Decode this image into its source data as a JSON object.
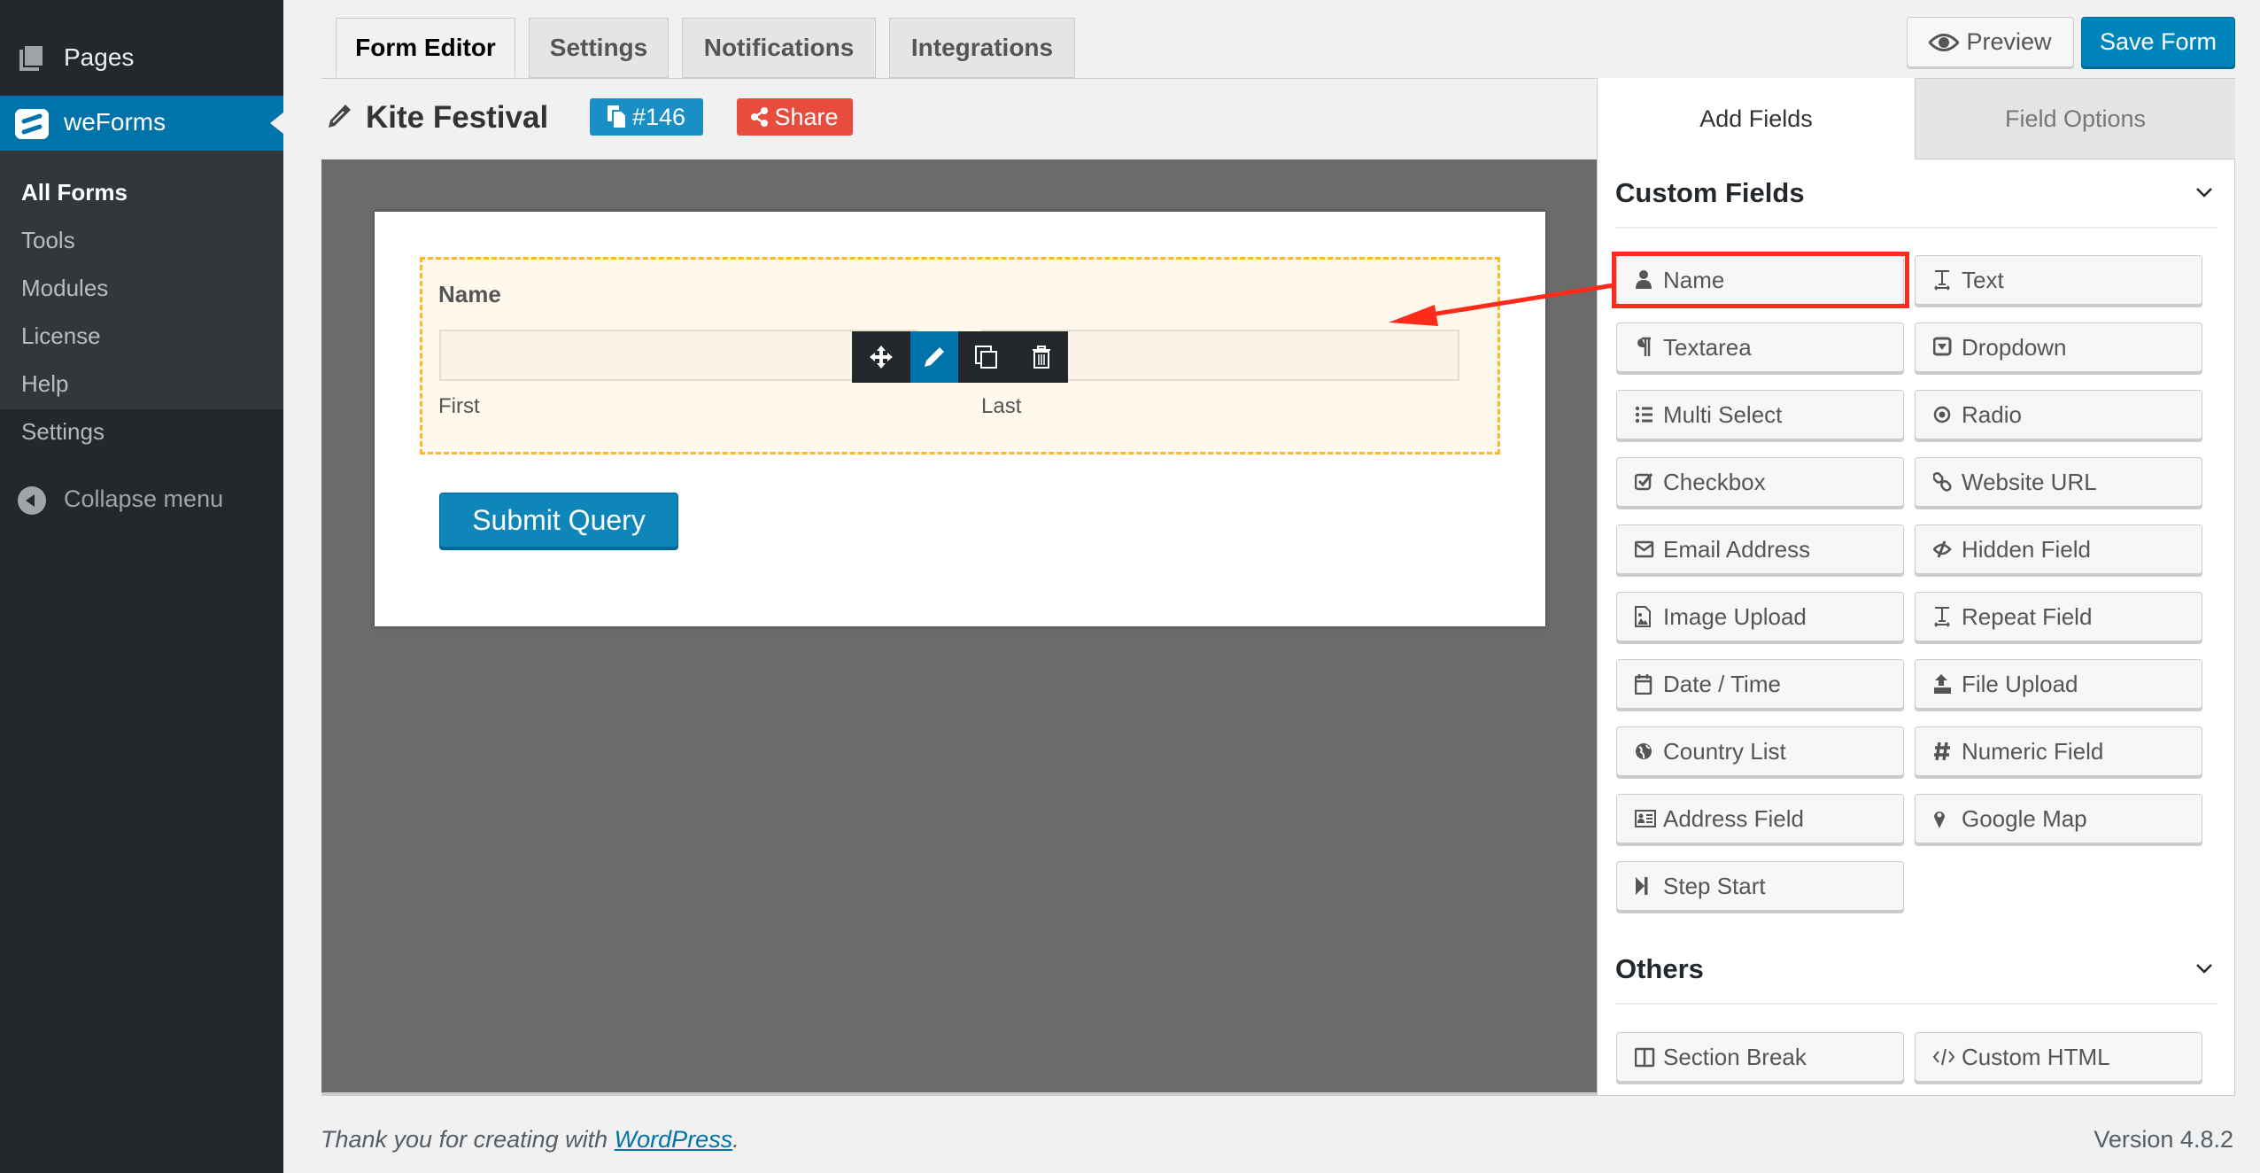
{
  "sidebar": {
    "pages_label": "Pages",
    "plugin_label": "weForms",
    "submenu": [
      {
        "label": "All Forms",
        "current": true
      },
      {
        "label": "Tools",
        "current": false
      },
      {
        "label": "Modules",
        "current": false
      },
      {
        "label": "License",
        "current": false
      },
      {
        "label": "Help",
        "current": false
      },
      {
        "label": "Settings",
        "current": false
      }
    ],
    "collapse_label": "Collapse menu"
  },
  "tabs": [
    {
      "label": "Form Editor",
      "active": true
    },
    {
      "label": "Settings",
      "active": false
    },
    {
      "label": "Notifications",
      "active": false
    },
    {
      "label": "Integrations",
      "active": false
    }
  ],
  "actions": {
    "preview_label": "Preview",
    "save_label": "Save Form"
  },
  "form": {
    "title": "Kite Festival",
    "id_badge": "#146",
    "share_label": "Share",
    "field": {
      "label": "Name",
      "sub_labels": {
        "first": "First",
        "last": "Last"
      }
    },
    "submit_label": "Submit Query"
  },
  "panel": {
    "tabs": [
      {
        "label": "Add Fields",
        "active": true
      },
      {
        "label": "Field Options",
        "active": false
      }
    ],
    "sections": [
      {
        "title": "Custom Fields",
        "fields": [
          {
            "label": "Name",
            "icon": "user-icon",
            "highlighted": true
          },
          {
            "label": "Text",
            "icon": "text-icon"
          },
          {
            "label": "Textarea",
            "icon": "paragraph-icon"
          },
          {
            "label": "Dropdown",
            "icon": "dropdown-icon"
          },
          {
            "label": "Multi Select",
            "icon": "list-icon"
          },
          {
            "label": "Radio",
            "icon": "radio-icon"
          },
          {
            "label": "Checkbox",
            "icon": "checkbox-icon"
          },
          {
            "label": "Website URL",
            "icon": "link-icon"
          },
          {
            "label": "Email Address",
            "icon": "envelope-icon"
          },
          {
            "label": "Hidden Field",
            "icon": "eye-slash-icon"
          },
          {
            "label": "Image Upload",
            "icon": "image-file-icon"
          },
          {
            "label": "Repeat Field",
            "icon": "text-icon"
          },
          {
            "label": "Date / Time",
            "icon": "calendar-icon"
          },
          {
            "label": "File Upload",
            "icon": "upload-icon"
          },
          {
            "label": "Country List",
            "icon": "globe-icon"
          },
          {
            "label": "Numeric Field",
            "icon": "hash-icon"
          },
          {
            "label": "Address Field",
            "icon": "address-card-icon"
          },
          {
            "label": "Google Map",
            "icon": "map-marker-icon"
          },
          {
            "label": "Step Start",
            "icon": "step-forward-icon"
          }
        ]
      },
      {
        "title": "Others",
        "fields": [
          {
            "label": "Section Break",
            "icon": "columns-icon"
          },
          {
            "label": "Custom HTML",
            "icon": "code-icon"
          }
        ]
      }
    ]
  },
  "footer": {
    "thanks_prefix": "Thank you for creating with ",
    "link_text": "WordPress",
    "thanks_suffix": ".",
    "version": "Version 4.8.2"
  },
  "colors": {
    "wp_blue": "#0073aa",
    "sidebar_bg": "#23282d",
    "share_red": "#e74c3c",
    "highlight_red": "#ff2a1a",
    "dashed_border": "#fbb828"
  }
}
